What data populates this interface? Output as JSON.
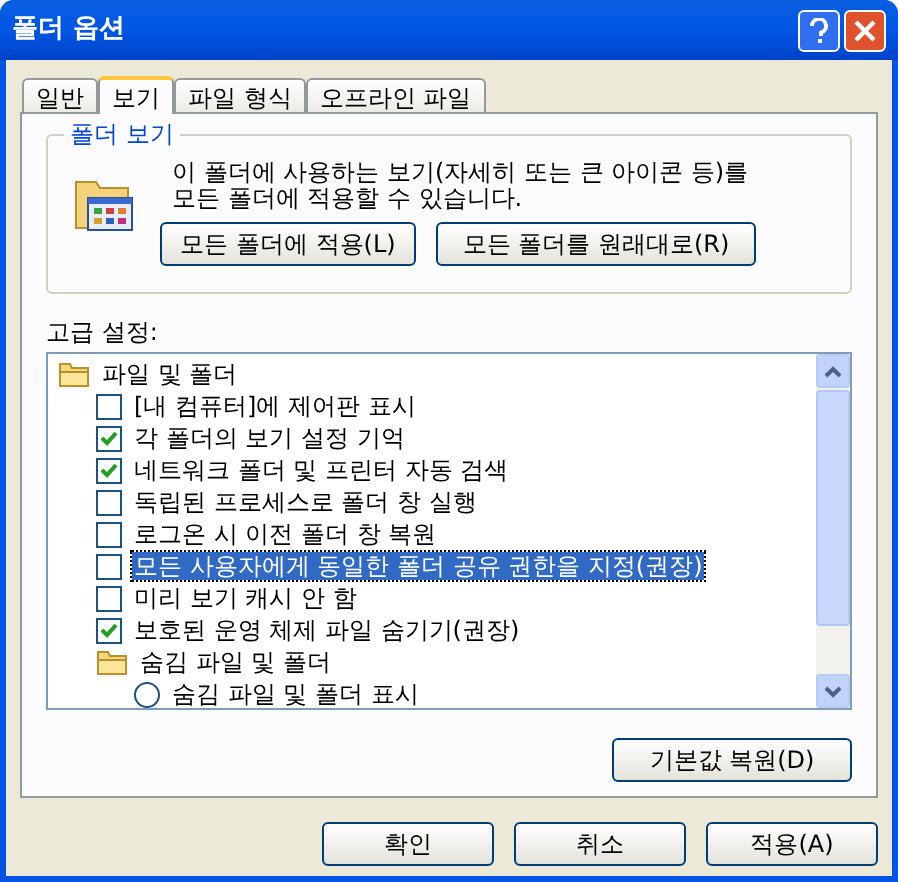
{
  "window": {
    "title": "폴더 옵션"
  },
  "tabs": [
    {
      "label": "일반",
      "selected": false
    },
    {
      "label": "보기",
      "selected": true
    },
    {
      "label": "파일 형식",
      "selected": false
    },
    {
      "label": "오프라인 파일",
      "selected": false
    }
  ],
  "folder_views": {
    "title": "폴더 보기",
    "description": "이 폴더에 사용하는 보기(자세히 또는 큰 아이콘 등)를 모든 폴더에  적용할 수 있습니다.",
    "buttons": [
      "모든 폴더에 적용(L)",
      "모든 폴더를 원래대로(R)"
    ]
  },
  "advanced": {
    "label": "고급 설정:",
    "items": [
      {
        "kind": "folder",
        "label": "파일 및 폴더",
        "children": [
          {
            "kind": "checkbox",
            "label": "[내 컴퓨터]에 제어판 표시",
            "checked": false,
            "selected": false
          },
          {
            "kind": "checkbox",
            "label": "각 폴더의 보기 설정 기억",
            "checked": true,
            "selected": false
          },
          {
            "kind": "checkbox",
            "label": "네트워크 폴더 및 프린터 자동 검색",
            "checked": true,
            "selected": false
          },
          {
            "kind": "checkbox",
            "label": "독립된 프로세스로 폴더 창 실행",
            "checked": false,
            "selected": false
          },
          {
            "kind": "checkbox",
            "label": "로그온 시 이전 폴더 창 복원",
            "checked": false,
            "selected": false
          },
          {
            "kind": "checkbox",
            "label": "모든 사용자에게 동일한 폴더 공유 권한을 지정(권장)",
            "checked": false,
            "selected": true
          },
          {
            "kind": "checkbox",
            "label": "미리 보기 캐시 안 함",
            "checked": false,
            "selected": false
          },
          {
            "kind": "checkbox",
            "label": "보호된 운영 체제 파일 숨기기(권장)",
            "checked": true,
            "selected": false
          },
          {
            "kind": "folder",
            "label": "숨김 파일 및 폴더",
            "children": [
              {
                "kind": "radio",
                "label": "숨김 파일 및 폴더 표시",
                "checked": false,
                "selected": false
              }
            ]
          }
        ]
      }
    ],
    "restore_button": "기본값 복원(D)"
  },
  "buttons": [
    "확인",
    "취소",
    "적용(A)"
  ]
}
